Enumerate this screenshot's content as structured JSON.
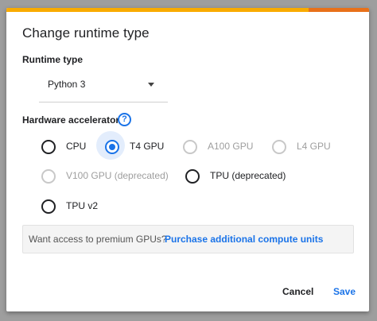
{
  "dialog": {
    "title": "Change runtime type",
    "runtime_type": {
      "label": "Runtime type",
      "selected": "Python 3"
    },
    "accelerator": {
      "label": "Hardware accelerator",
      "help_icon": "?",
      "options": [
        {
          "label": "CPU",
          "state": "enabled"
        },
        {
          "label": "T4 GPU",
          "state": "selected"
        },
        {
          "label": "A100 GPU",
          "state": "disabled"
        },
        {
          "label": "L4 GPU",
          "state": "disabled"
        },
        {
          "label": "V100 GPU (deprecated)",
          "state": "disabled"
        },
        {
          "label": "TPU (deprecated)",
          "state": "enabled"
        },
        {
          "label": "TPU v2",
          "state": "enabled"
        }
      ]
    },
    "promo": {
      "text": "Want access to premium GPUs?",
      "link": "Purchase additional compute units"
    },
    "buttons": {
      "cancel": "Cancel",
      "save": "Save"
    },
    "colors": {
      "accent": "#1a73e8",
      "top_bar": "#f9ab00",
      "top_bar_end": "#e8711a"
    }
  }
}
